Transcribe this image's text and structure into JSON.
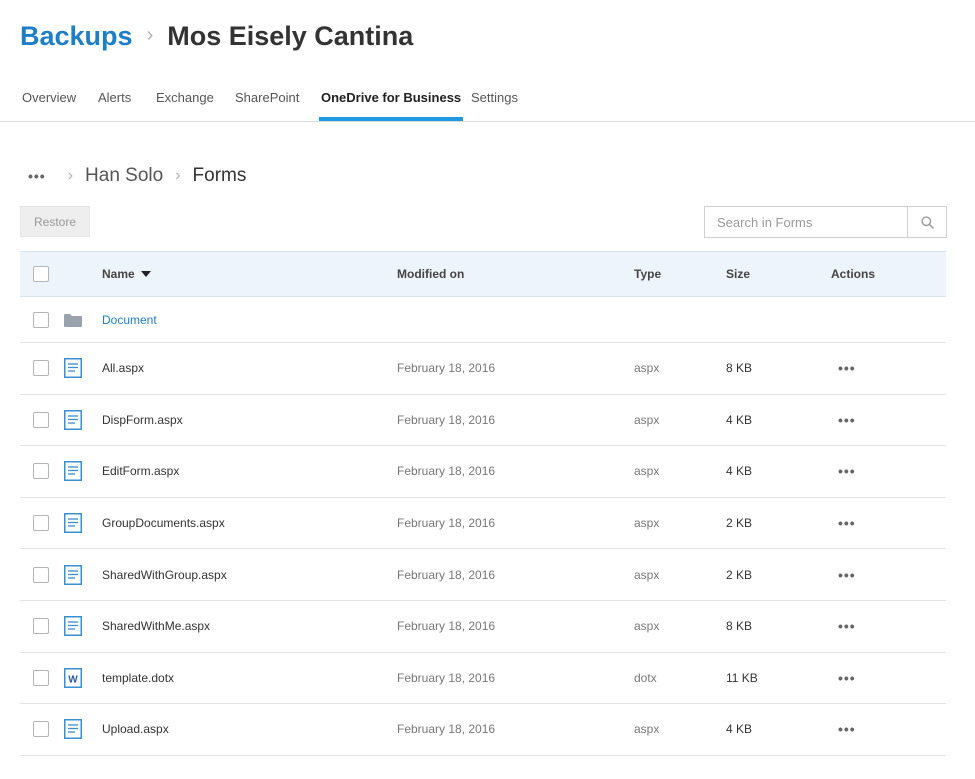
{
  "header": {
    "root": "Backups",
    "current": "Mos Eisely Cantina"
  },
  "tabs": [
    {
      "label": "Overview",
      "active": false
    },
    {
      "label": "Alerts",
      "active": false
    },
    {
      "label": "Exchange",
      "active": false
    },
    {
      "label": "SharePoint",
      "active": false
    },
    {
      "label": "OneDrive for Business",
      "active": true
    },
    {
      "label": "Settings",
      "active": false
    }
  ],
  "folder_breadcrumb": {
    "more": "•••",
    "parent": "Han Solo",
    "current": "Forms"
  },
  "toolbar": {
    "restore_label": "Restore"
  },
  "search": {
    "placeholder": "Search in Forms",
    "icon": "search-icon"
  },
  "table": {
    "columns": {
      "name": "Name",
      "modified": "Modified on",
      "type": "Type",
      "size": "Size",
      "actions": "Actions"
    },
    "sort": {
      "column": "name",
      "direction": "desc"
    },
    "folder": {
      "name": "Document",
      "icon": "folder-icon"
    },
    "rows": [
      {
        "name": "All.aspx",
        "modified": "February 18, 2016",
        "type": "aspx",
        "size": "8 KB",
        "icon": "page-icon"
      },
      {
        "name": "DispForm.aspx",
        "modified": "February 18, 2016",
        "type": "aspx",
        "size": "4 KB",
        "icon": "page-icon"
      },
      {
        "name": "EditForm.aspx",
        "modified": "February 18, 2016",
        "type": "aspx",
        "size": "4 KB",
        "icon": "page-icon"
      },
      {
        "name": "GroupDocuments.aspx",
        "modified": "February 18, 2016",
        "type": "aspx",
        "size": "2 KB",
        "icon": "page-icon"
      },
      {
        "name": "SharedWithGroup.aspx",
        "modified": "February 18, 2016",
        "type": "aspx",
        "size": "2 KB",
        "icon": "page-icon"
      },
      {
        "name": "SharedWithMe.aspx",
        "modified": "February 18, 2016",
        "type": "aspx",
        "size": "8 KB",
        "icon": "page-icon"
      },
      {
        "name": "template.dotx",
        "modified": "February 18, 2016",
        "type": "dotx",
        "size": "11 KB",
        "icon": "word-icon"
      },
      {
        "name": "Upload.aspx",
        "modified": "February 18, 2016",
        "type": "aspx",
        "size": "4 KB",
        "icon": "page-icon"
      }
    ],
    "actions_glyph": "•••"
  },
  "colors": {
    "accent": "#1e7ec8",
    "tab_underline": "#1e9be0",
    "header_bg": "#eef4fb",
    "icon_blue": "#3a8fd0"
  }
}
